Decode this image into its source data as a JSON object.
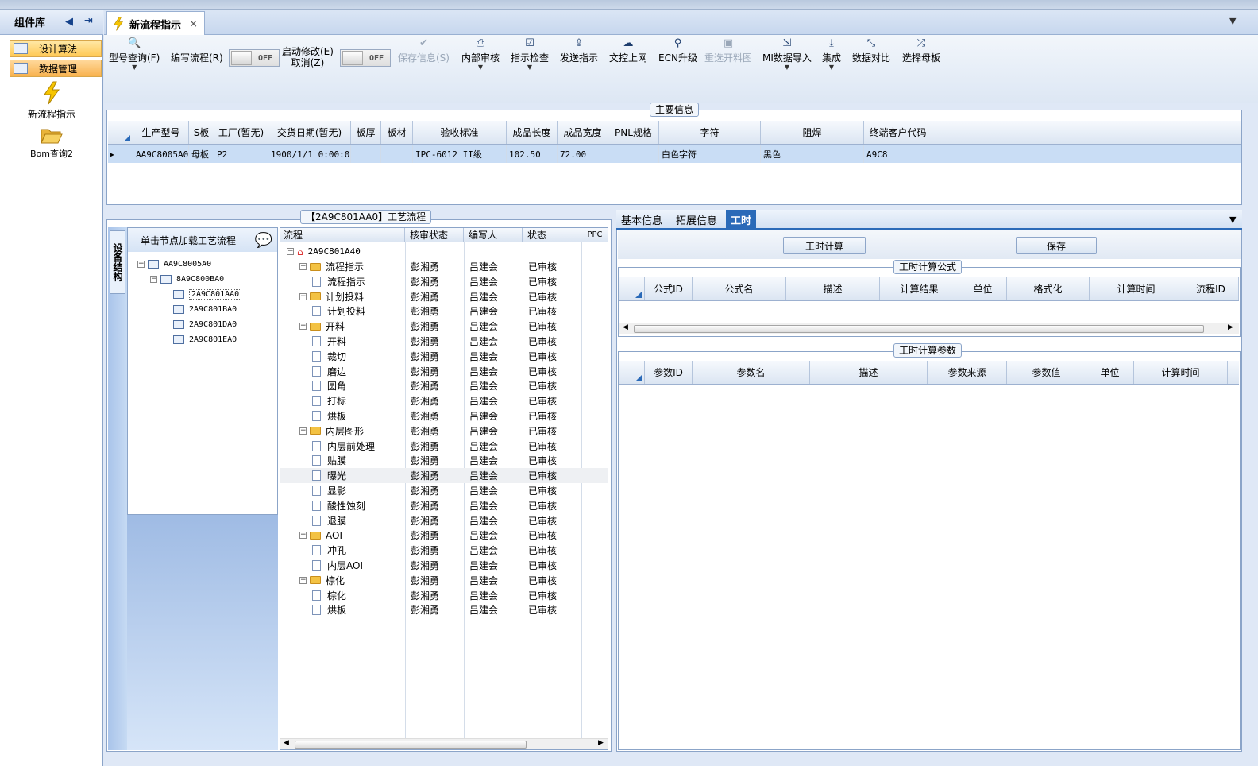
{
  "sidebar": {
    "title": "组件库",
    "nav": [
      "设计算法",
      "数据管理"
    ],
    "items": [
      {
        "label": "新流程指示",
        "icon": "lightning-icon"
      },
      {
        "label": "Bom查询2",
        "icon": "folder-open-icon"
      }
    ]
  },
  "tab": {
    "title": "新流程指示",
    "close": "×"
  },
  "toolbar": {
    "query_label": "型号查询(F)",
    "write_label": "编写流程(R)",
    "toggle1": "OFF",
    "start_edit_label1": "启动修改(E)",
    "start_edit_label2": "取消(Z)",
    "toggle2": "OFF",
    "save_label": "保存信息(S)",
    "internal_review": "内部审核",
    "check": "指示检查",
    "send": "发送指示",
    "upload": "文控上网",
    "ecn": "ECN升级",
    "reselect": "重选开料图",
    "mi_import": "MI数据导入",
    "integrate": "集成",
    "compare": "数据对比",
    "template": "选择母板"
  },
  "main_info": {
    "title": "主要信息",
    "columns": [
      "生产型号",
      "S板",
      "工厂(暂无)",
      "交货日期(暂无)",
      "板厚",
      "板材",
      "验收标准",
      "成品长度",
      "成品宽度",
      "PNL规格",
      "字符",
      "阻焊",
      "终端客户代码"
    ],
    "row": [
      "AA9C8005A0",
      "母板",
      "P2",
      "1900/1/1 0:00:00",
      "",
      "",
      "IPC-6012 II级",
      "102.50",
      "72.00",
      "",
      "白色字符",
      "黑色",
      "A9C8"
    ]
  },
  "process": {
    "title": "【2A9C801AA0】工艺流程",
    "vertical_tab": "设备结构",
    "hint": "单击节点加载工艺流程",
    "struct_tree": [
      "AA9C8005A0",
      "8A9C800BA0",
      "2A9C801AA0",
      "2A9C801BA0",
      "2A9C801DA0",
      "2A9C801EA0"
    ],
    "columns": [
      "流程",
      "核审状态",
      "编写人",
      "状态",
      "PPC"
    ],
    "root": "2A9C801A40",
    "rows": [
      {
        "name": "流程指示",
        "folder": true,
        "a": "彭湘勇",
        "b": "吕建会",
        "c": "已审核"
      },
      {
        "name": "流程指示",
        "folder": false,
        "a": "彭湘勇",
        "b": "吕建会",
        "c": "已审核"
      },
      {
        "name": "计划投料",
        "folder": true,
        "a": "彭湘勇",
        "b": "吕建会",
        "c": "已审核"
      },
      {
        "name": "计划投料",
        "folder": false,
        "a": "彭湘勇",
        "b": "吕建会",
        "c": "已审核"
      },
      {
        "name": "开料",
        "folder": true,
        "a": "彭湘勇",
        "b": "吕建会",
        "c": "已审核"
      },
      {
        "name": "开料",
        "folder": false,
        "a": "彭湘勇",
        "b": "吕建会",
        "c": "已审核"
      },
      {
        "name": "裁切",
        "folder": false,
        "a": "彭湘勇",
        "b": "吕建会",
        "c": "已审核"
      },
      {
        "name": "磨边",
        "folder": false,
        "a": "彭湘勇",
        "b": "吕建会",
        "c": "已审核"
      },
      {
        "name": "圆角",
        "folder": false,
        "a": "彭湘勇",
        "b": "吕建会",
        "c": "已审核"
      },
      {
        "name": "打标",
        "folder": false,
        "a": "彭湘勇",
        "b": "吕建会",
        "c": "已审核"
      },
      {
        "name": "烘板",
        "folder": false,
        "a": "彭湘勇",
        "b": "吕建会",
        "c": "已审核"
      },
      {
        "name": "内层图形",
        "folder": true,
        "a": "彭湘勇",
        "b": "吕建会",
        "c": "已审核"
      },
      {
        "name": "内层前处理",
        "folder": false,
        "a": "彭湘勇",
        "b": "吕建会",
        "c": "已审核"
      },
      {
        "name": "贴膜",
        "folder": false,
        "a": "彭湘勇",
        "b": "吕建会",
        "c": "已审核"
      },
      {
        "name": "曝光",
        "folder": false,
        "a": "彭湘勇",
        "b": "吕建会",
        "c": "已审核"
      },
      {
        "name": "显影",
        "folder": false,
        "a": "彭湘勇",
        "b": "吕建会",
        "c": "已审核"
      },
      {
        "name": "酸性蚀刻",
        "folder": false,
        "a": "彭湘勇",
        "b": "吕建会",
        "c": "已审核"
      },
      {
        "name": "退膜",
        "folder": false,
        "a": "彭湘勇",
        "b": "吕建会",
        "c": "已审核"
      },
      {
        "name": "AOI",
        "folder": true,
        "a": "彭湘勇",
        "b": "吕建会",
        "c": "已审核"
      },
      {
        "name": "冲孔",
        "folder": false,
        "a": "彭湘勇",
        "b": "吕建会",
        "c": "已审核"
      },
      {
        "name": "内层AOI",
        "folder": false,
        "a": "彭湘勇",
        "b": "吕建会",
        "c": "已审核"
      },
      {
        "name": "棕化",
        "folder": true,
        "a": "彭湘勇",
        "b": "吕建会",
        "c": "已审核"
      },
      {
        "name": "棕化",
        "folder": false,
        "a": "彭湘勇",
        "b": "吕建会",
        "c": "已审核"
      },
      {
        "name": "烘板",
        "folder": false,
        "a": "彭湘勇",
        "b": "吕建会",
        "c": "已审核"
      }
    ]
  },
  "right": {
    "tabs": [
      "基本信息",
      "拓展信息",
      "工时"
    ],
    "calc_button": "工时计算",
    "save_button": "保存",
    "formula_title": "工时计算公式",
    "formula_columns": [
      "公式ID",
      "公式名",
      "描述",
      "计算结果",
      "单位",
      "格式化",
      "计算时间",
      "流程ID"
    ],
    "param_title": "工时计算参数",
    "param_columns": [
      "参数ID",
      "参数名",
      "描述",
      "参数来源",
      "参数值",
      "单位",
      "计算时间"
    ]
  },
  "colors": {
    "accent": "#2a6ab8",
    "selected_row": "#c9ddf5",
    "nav_active": "#ffc956"
  }
}
